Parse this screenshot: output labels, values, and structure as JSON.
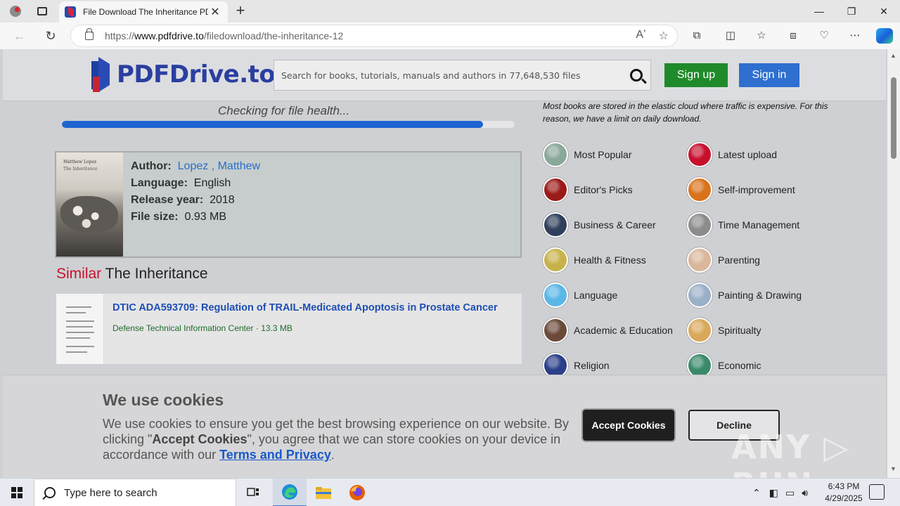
{
  "browser": {
    "tab_title": "File Download The Inheritance PDF",
    "url_prefix": "https://",
    "url_domain": "www.pdfdrive.to",
    "url_path": "/filedownload/the-inheritance-12",
    "window_min": "—",
    "window_max": "❐",
    "window_close": "✕"
  },
  "site": {
    "logo_text": "PDFDrive.to",
    "search_placeholder": "Search for books, tutorials, manuals and authors in 77,648,530 files",
    "signup_label": "Sign up",
    "signin_label": "Sign in"
  },
  "download": {
    "status_text": "Checking for file health...",
    "progress": 0.93
  },
  "book": {
    "cover_author": "Matthew Lopez",
    "cover_title": "The Inheritance",
    "author_label": "Author:",
    "author_last": "Lopez",
    "author_first": ", Matthew",
    "language_label": "Language:",
    "language": "English",
    "year_label": "Release year:",
    "year": "2018",
    "size_label": "File size:",
    "size": "0.93 MB"
  },
  "similar": {
    "heading_red": "Similar",
    "heading_rest": " The Inheritance",
    "items": [
      {
        "title": "DTIC ADA593709: Regulation of TRAIL-Medicated Apoptosis in Prostate Cancer",
        "source": "Defense Technical Information Center",
        "size": " · 13.3 MB"
      }
    ]
  },
  "sidebar": {
    "note": "Most books are stored in the elastic cloud where traffic is expensive. For this reason, we have a limit on daily download.",
    "categories": [
      {
        "label": "Most Popular",
        "color": "#8aa89a"
      },
      {
        "label": "Latest upload",
        "color": "#c8102e"
      },
      {
        "label": "Editor's Picks",
        "color": "#9b1a1a"
      },
      {
        "label": "Self-improvement",
        "color": "#d8731c"
      },
      {
        "label": "Business & Career",
        "color": "#2f3f5c"
      },
      {
        "label": "Time Management",
        "color": "#8c8c8c"
      },
      {
        "label": "Health & Fitness",
        "color": "#c7b24a"
      },
      {
        "label": "Parenting",
        "color": "#d9b79a"
      },
      {
        "label": "Language",
        "color": "#5bb7e6"
      },
      {
        "label": "Painting & Drawing",
        "color": "#9ab0c8"
      },
      {
        "label": "Academic & Education",
        "color": "#6b4a3a"
      },
      {
        "label": "Spiritualty",
        "color": "#d9a85a"
      },
      {
        "label": "Religion",
        "color": "#2a3f8a"
      },
      {
        "label": "Economic",
        "color": "#3a8a6a"
      }
    ]
  },
  "cookie": {
    "heading": "We use cookies",
    "text_1": "We use cookies to ensure you get the best browsing experience on our website. By clicking \"",
    "text_bold": "Accept Cookies",
    "text_2": "\", you agree that we can store cookies on your device in accordance with our ",
    "link": "Terms and Privacy",
    "text_3": ".",
    "accept_label": "Accept Cookies",
    "decline_label": "Decline",
    "watermark": "ANY ▷ RUN"
  },
  "taskbar": {
    "search_placeholder": "Type here to search",
    "time": "6:43 PM",
    "date": "4/29/2025"
  }
}
